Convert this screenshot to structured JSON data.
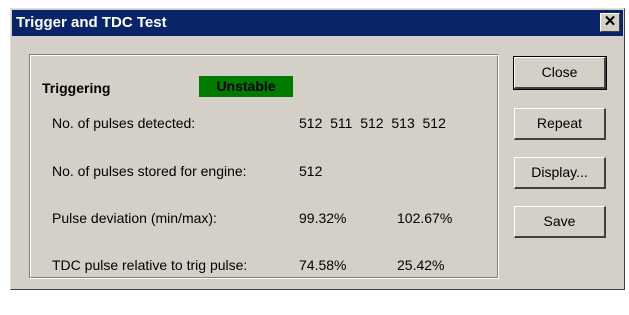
{
  "window": {
    "title": "Trigger and TDC Test",
    "close_glyph": "✕"
  },
  "status": {
    "label": "Triggering",
    "badge": "Unstable",
    "badge_color": "#007a00"
  },
  "rows": [
    {
      "label": "No. of pulses detected:",
      "values": [
        "512  511  512  513  512"
      ]
    },
    {
      "label": "No. of pulses stored for engine:",
      "values": [
        "512"
      ]
    },
    {
      "label": "Pulse deviation (min/max):",
      "values": [
        "99.32%",
        "102.67%"
      ]
    },
    {
      "label": "TDC pulse relative to trig pulse:",
      "values": [
        "74.58%",
        "25.42%"
      ]
    }
  ],
  "buttons": {
    "close": "Close",
    "repeat": "Repeat",
    "display": "Display...",
    "save": "Save"
  }
}
